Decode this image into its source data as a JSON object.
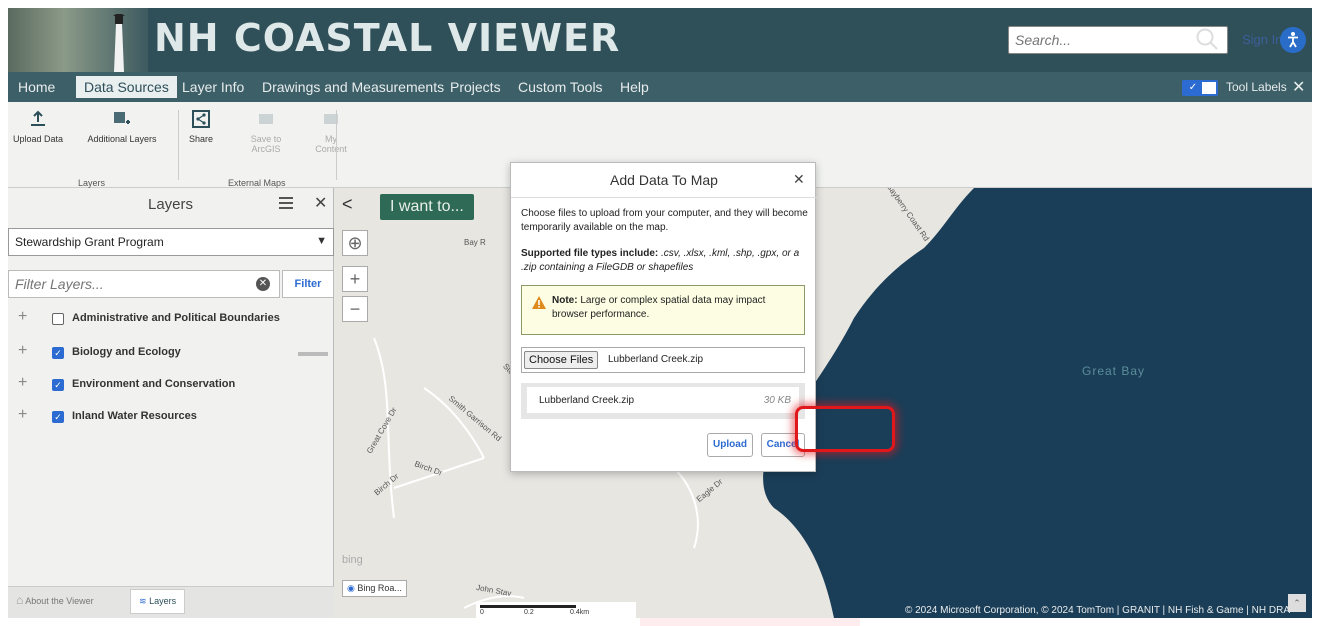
{
  "header": {
    "title": "NH COASTAL VIEWER",
    "search_placeholder": "Search...",
    "signin": "Sign In"
  },
  "menu": {
    "items": [
      "Home",
      "Data Sources",
      "Layer Info",
      "Drawings and Measurements",
      "Projects",
      "Custom Tools",
      "Help"
    ],
    "active": "Data Sources",
    "tool_labels": "Tool Labels",
    "tool_labels_on": true
  },
  "ribbon": {
    "buttons": [
      {
        "label": "Upload Data",
        "icon": "upload-icon",
        "enabled": true
      },
      {
        "label": "Additional Layers",
        "icon": "add-layers-icon",
        "enabled": true
      },
      {
        "label": "Share",
        "icon": "share-icon",
        "enabled": true
      },
      {
        "label": "Save to ArcGIS",
        "icon": "arcgis-save-icon",
        "enabled": false
      },
      {
        "label": "My Content",
        "icon": "my-content-icon",
        "enabled": false
      }
    ],
    "groups": [
      "Layers",
      "External Maps"
    ]
  },
  "layers_panel": {
    "title": "Layers",
    "selected_group": "Stewardship Grant Program",
    "filter_placeholder": "Filter Layers...",
    "filter_button": "Filter",
    "layers": [
      {
        "label": "Administrative and Political Boundaries",
        "checked": false
      },
      {
        "label": "Biology and Ecology",
        "checked": true
      },
      {
        "label": "Environment and Conservation",
        "checked": true
      },
      {
        "label": "Inland Water Resources",
        "checked": true
      }
    ],
    "bottom_tabs": [
      "About the Viewer",
      "Layers"
    ]
  },
  "map": {
    "i_want_to": "I want to...",
    "water_label": "Great Bay",
    "road_labels": [
      "Bay R",
      "Bayberry Coast Rd",
      "Smith Garrison Rd",
      "Great Cove Dr",
      "Birch Dr",
      "Birch Dr",
      "Eagle Dr",
      "Stev",
      "John Stav"
    ],
    "basemap_label": "Bing Roa...",
    "bing_logo": "bing",
    "scale_labels": [
      "0",
      "0.2",
      "0.4km"
    ],
    "attribution": "© 2024 Microsoft Corporation, © 2024 TomTom | GRANIT | NH Fish & Game | NH DRA"
  },
  "dialog": {
    "title": "Add Data To Map",
    "intro": "Choose files to upload from your computer, and they will become temporarily available on the map.",
    "types_heading": "Supported file types include:",
    "types_list": ".csv, .xlsx, .kml, .shp, .gpx, or a .zip containing a FileGDB or shapefiles",
    "note_label": "Note:",
    "note_text": "Large or complex spatial data may impact browser performance.",
    "choose_button": "Choose Files",
    "chosen_file": "Lubberland Creek.zip",
    "file_item_name": "Lubberland Creek.zip",
    "file_item_size": "30 KB",
    "upload_button": "Upload",
    "cancel_button": "Cancel"
  },
  "colors": {
    "header_bg": "#2f5059",
    "menu_bg": "#3d5f68",
    "accent_blue": "#2c6bd1",
    "iwant_green": "#2e6a55",
    "highlight_red": "#e0181b"
  }
}
